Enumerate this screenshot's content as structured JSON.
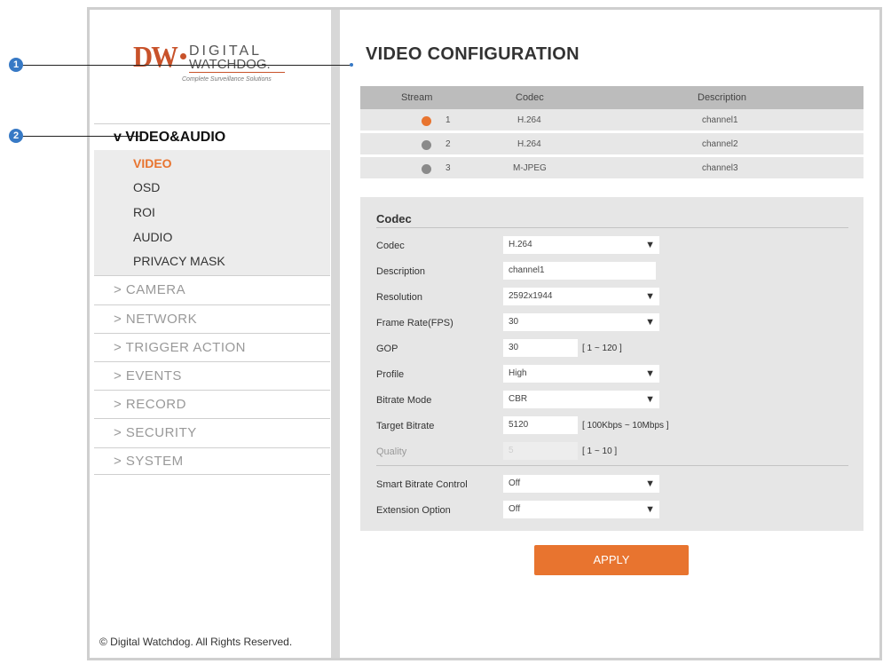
{
  "callouts": [
    "1",
    "2"
  ],
  "logo": {
    "brand": "DW",
    "line1": "DIGITAL",
    "line2": "WATCHDOG.",
    "tagline": "Complete Surveillance Solutions"
  },
  "sidebar": {
    "active_section": "v VIDEO&AUDIO",
    "sub_items": [
      {
        "label": "VIDEO",
        "active": true
      },
      {
        "label": "OSD"
      },
      {
        "label": "ROI"
      },
      {
        "label": "AUDIO"
      },
      {
        "label": "PRIVACY MASK"
      }
    ],
    "sections": [
      "> CAMERA",
      "> NETWORK",
      "> TRIGGER ACTION",
      "> EVENTS",
      "> RECORD",
      "> SECURITY",
      "> SYSTEM"
    ],
    "copyright": "© Digital Watchdog. All Rights Reserved."
  },
  "page": {
    "title": "VIDEO CONFIGURATION"
  },
  "stream_table": {
    "headers": [
      "Stream",
      "Codec",
      "Description"
    ],
    "rows": [
      {
        "stream": "1",
        "codec": "H.264",
        "description": "channel1",
        "selected": true
      },
      {
        "stream": "2",
        "codec": "H.264",
        "description": "channel2"
      },
      {
        "stream": "3",
        "codec": "M-JPEG",
        "description": "channel3"
      }
    ]
  },
  "codec": {
    "section_title": "Codec",
    "fields": {
      "codec": {
        "label": "Codec",
        "value": "H.264"
      },
      "description": {
        "label": "Description",
        "value": "channel1"
      },
      "resolution": {
        "label": "Resolution",
        "value": "2592x1944"
      },
      "frame_rate": {
        "label": "Frame Rate(FPS)",
        "value": "30"
      },
      "gop": {
        "label": "GOP",
        "value": "30",
        "range": "[ 1 ~ 120 ]"
      },
      "profile": {
        "label": "Profile",
        "value": "High"
      },
      "bitrate_mode": {
        "label": "Bitrate Mode",
        "value": "CBR"
      },
      "target_bitrate": {
        "label": "Target Bitrate",
        "value": "5120",
        "range": "[ 100Kbps ~ 10Mbps ]"
      },
      "quality": {
        "label": "Quality",
        "value": "5",
        "range": "[ 1 ~ 10 ]"
      },
      "smart_bitrate": {
        "label": "Smart Bitrate Control",
        "value": "Off"
      },
      "extension_option": {
        "label": "Extension Option",
        "value": "Off"
      }
    }
  },
  "apply_label": "APPLY",
  "icons": {
    "dropdown": "▼"
  },
  "colors": {
    "accent": "#e8742f",
    "callout": "#3779c5"
  }
}
